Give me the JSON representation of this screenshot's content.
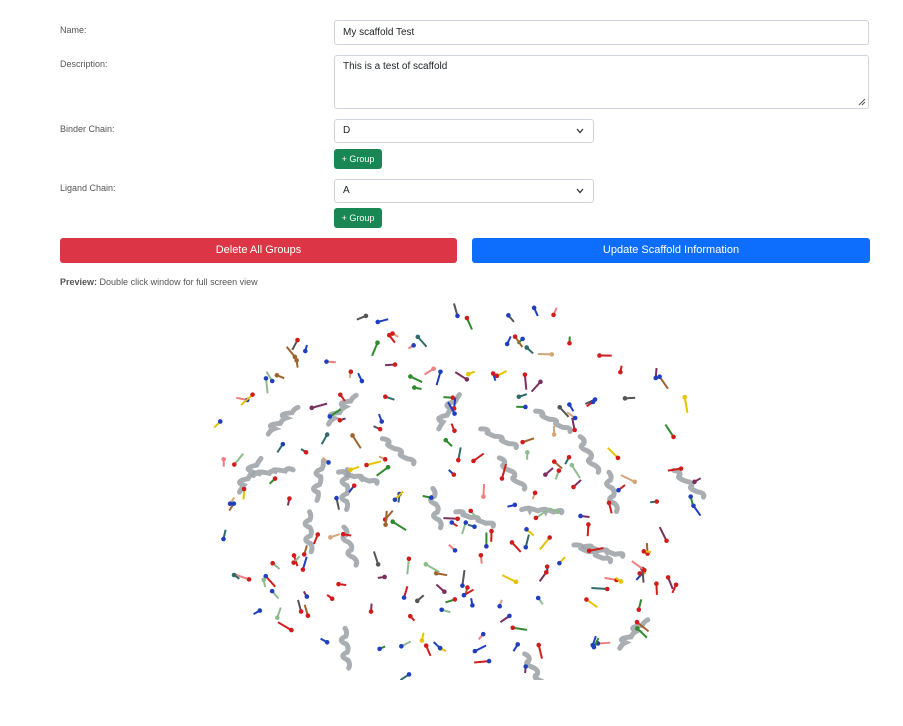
{
  "form": {
    "name_label": "Name:",
    "name_value": "My scaffold Test",
    "description_label": "Description:",
    "description_value": "This is a test of scaffold",
    "binder_chain_label": "Binder Chain:",
    "binder_chain_value": "D",
    "ligand_chain_label": "Ligand Chain:",
    "ligand_chain_value": "A",
    "add_group_label": "+ Group"
  },
  "actions": {
    "delete_label": "Delete All Groups",
    "update_label": "Update Scaffold Information"
  },
  "preview": {
    "label": "Preview:",
    "hint": "Double click window for full screen view"
  },
  "colors": {
    "success": "#198754",
    "danger": "#dc3545",
    "primary": "#0d6efd"
  }
}
